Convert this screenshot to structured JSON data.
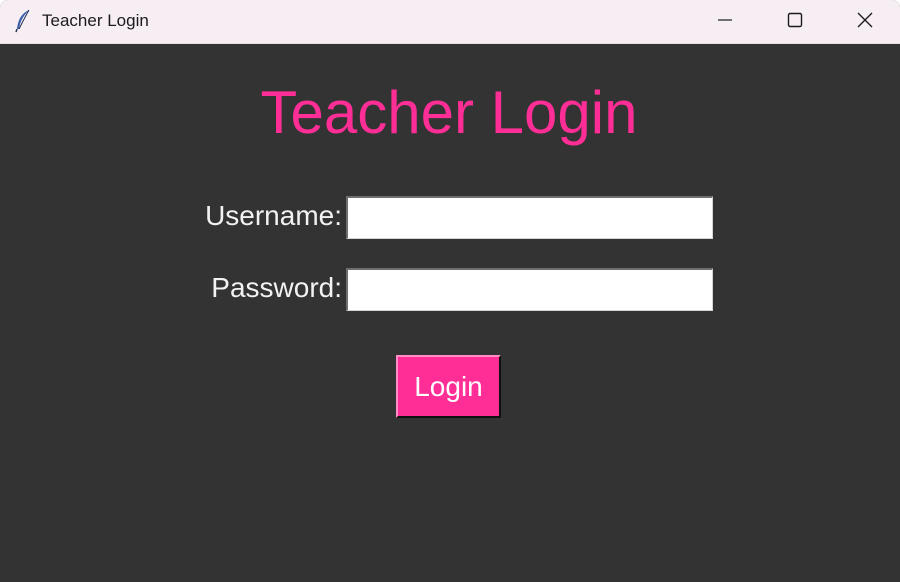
{
  "window": {
    "title": "Teacher Login",
    "icon": "feather-icon",
    "controls": [
      "minimize-icon",
      "maximize-icon",
      "close-icon"
    ]
  },
  "form": {
    "heading": "Teacher Login",
    "username_label": "Username:",
    "username_value": "",
    "password_label": "Password:",
    "password_value": "",
    "login_label": "Login"
  },
  "colors": {
    "background": "#333333",
    "accent": "#ff2e96",
    "label_text": "#f2f2f2",
    "titlebar": "#f6eef3"
  }
}
